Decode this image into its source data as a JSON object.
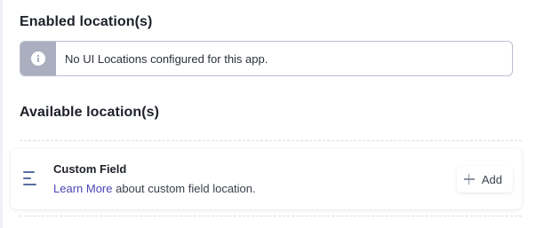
{
  "enabled_section": {
    "title": "Enabled location(s)",
    "notice": {
      "icon": "info-icon",
      "text": "No UI Locations configured for this app."
    }
  },
  "available_section": {
    "title": "Available location(s)",
    "locations": [
      {
        "icon": "custom-field-icon",
        "name": "Custom Field",
        "link_text": "Learn More",
        "description_suffix": " about custom field location.",
        "add_label": "Add"
      }
    ]
  },
  "colors": {
    "link": "#4e45b8",
    "notice_side": "#a9afbf",
    "icon_accent": "#5a6ea0"
  }
}
